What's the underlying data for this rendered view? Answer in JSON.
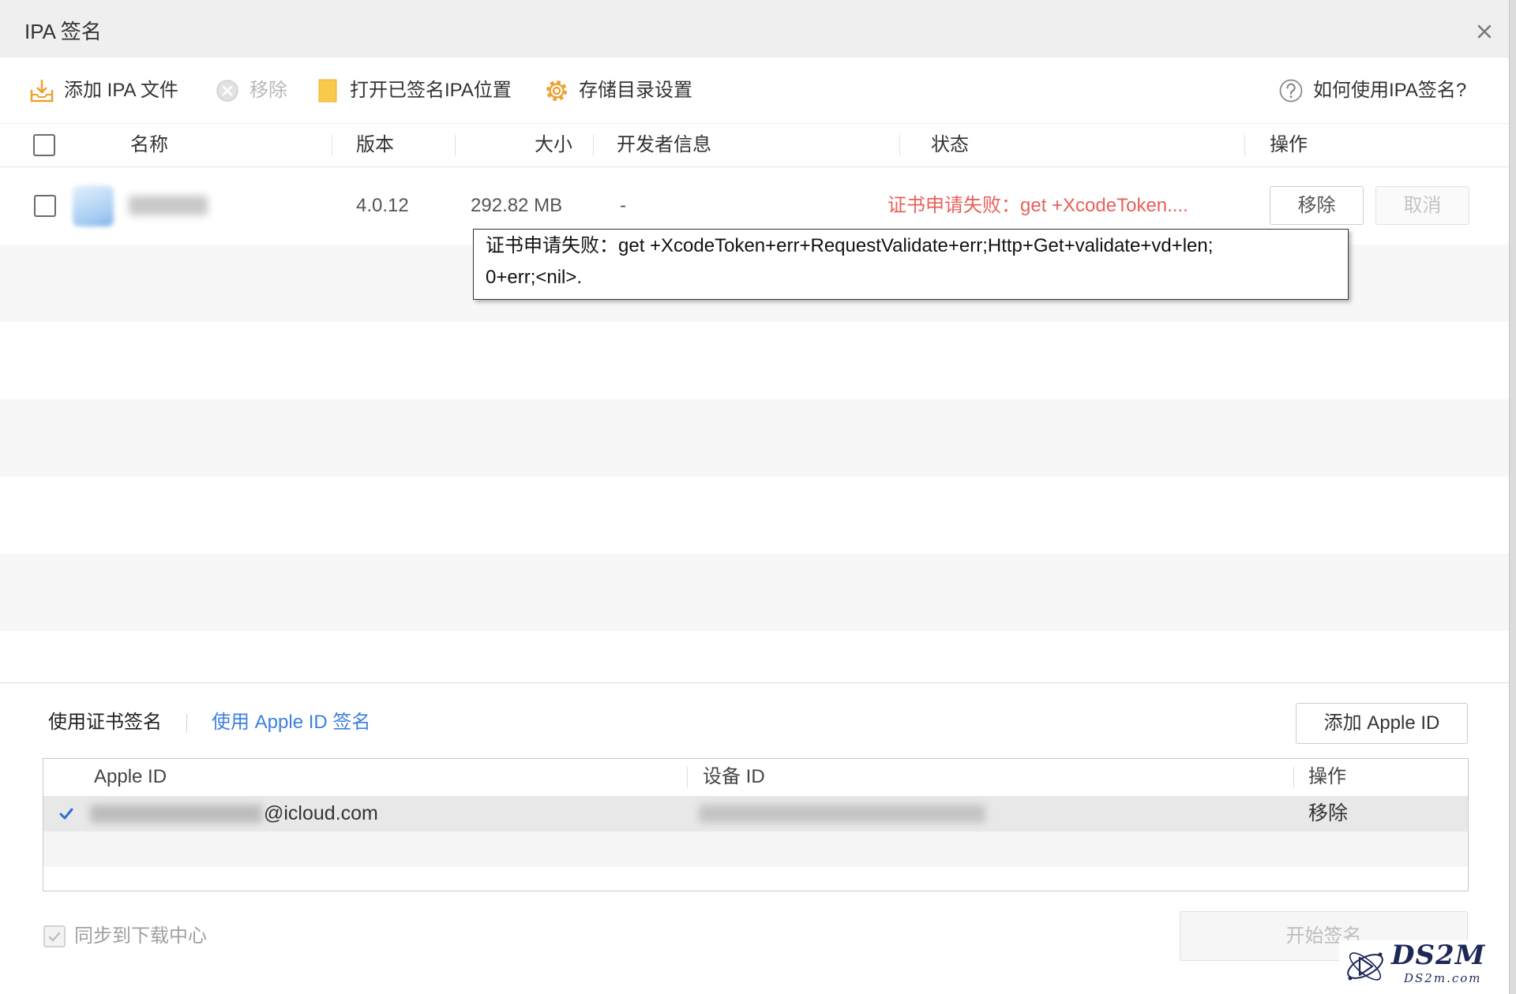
{
  "window": {
    "title": "IPA 签名"
  },
  "toolbar": {
    "add_ipa": "添加 IPA 文件",
    "remove": "移除",
    "remove_enabled": false,
    "open_signed_location": "打开已签名IPA位置",
    "storage_settings": "存储目录设置",
    "help": "如何使用IPA签名?"
  },
  "file_table": {
    "columns": {
      "name": "名称",
      "version": "版本",
      "size": "大小",
      "developer": "开发者信息",
      "status": "状态",
      "actions": "操作"
    },
    "rows": [
      {
        "checked": false,
        "version": "4.0.12",
        "size": "292.82 MB",
        "developer": "-",
        "status": "证书申请失败：get +XcodeToken....",
        "remove_button": "移除",
        "cancel_button": "取消",
        "cancel_enabled": false
      }
    ]
  },
  "status_tooltip": {
    "lines": [
      "证书申请失败：get +XcodeToken+err+RequestValidate+err;Http+Get+validate+vd+len;",
      "0+err;<nil>."
    ]
  },
  "signing": {
    "tabs": [
      {
        "label": "使用证书签名",
        "active": false
      },
      {
        "label": "使用 Apple ID 签名",
        "active": true
      }
    ],
    "add_apple_id_button": "添加 Apple ID",
    "apple_id_table": {
      "columns": {
        "apple_id": "Apple ID",
        "device_id": "设备 ID",
        "actions": "操作"
      },
      "rows": [
        {
          "selected": true,
          "apple_id_visible_part": "@icloud.com",
          "action": "移除"
        }
      ]
    },
    "sync_to_download_center": {
      "label": "同步到下载中心",
      "checked": true,
      "enabled": false
    },
    "start_button": {
      "label": "开始签名",
      "enabled": false
    }
  },
  "watermark": {
    "brand": "DS2M",
    "domain": "DS2m.com"
  },
  "colors": {
    "accent": "#3d7fe0",
    "error": "#e8605a",
    "icon_orange": "#f0a030",
    "folder_yellow": "#f9c94a",
    "check_blue": "#2f6fd8"
  },
  "icons": {
    "add_ipa": "import-file-icon",
    "remove": "remove-circle-icon",
    "open_signed_location": "folder-icon",
    "storage_settings": "gear-icon",
    "help": "help-circle-icon",
    "close": "close-icon",
    "selected_row": "checkmark-icon"
  }
}
